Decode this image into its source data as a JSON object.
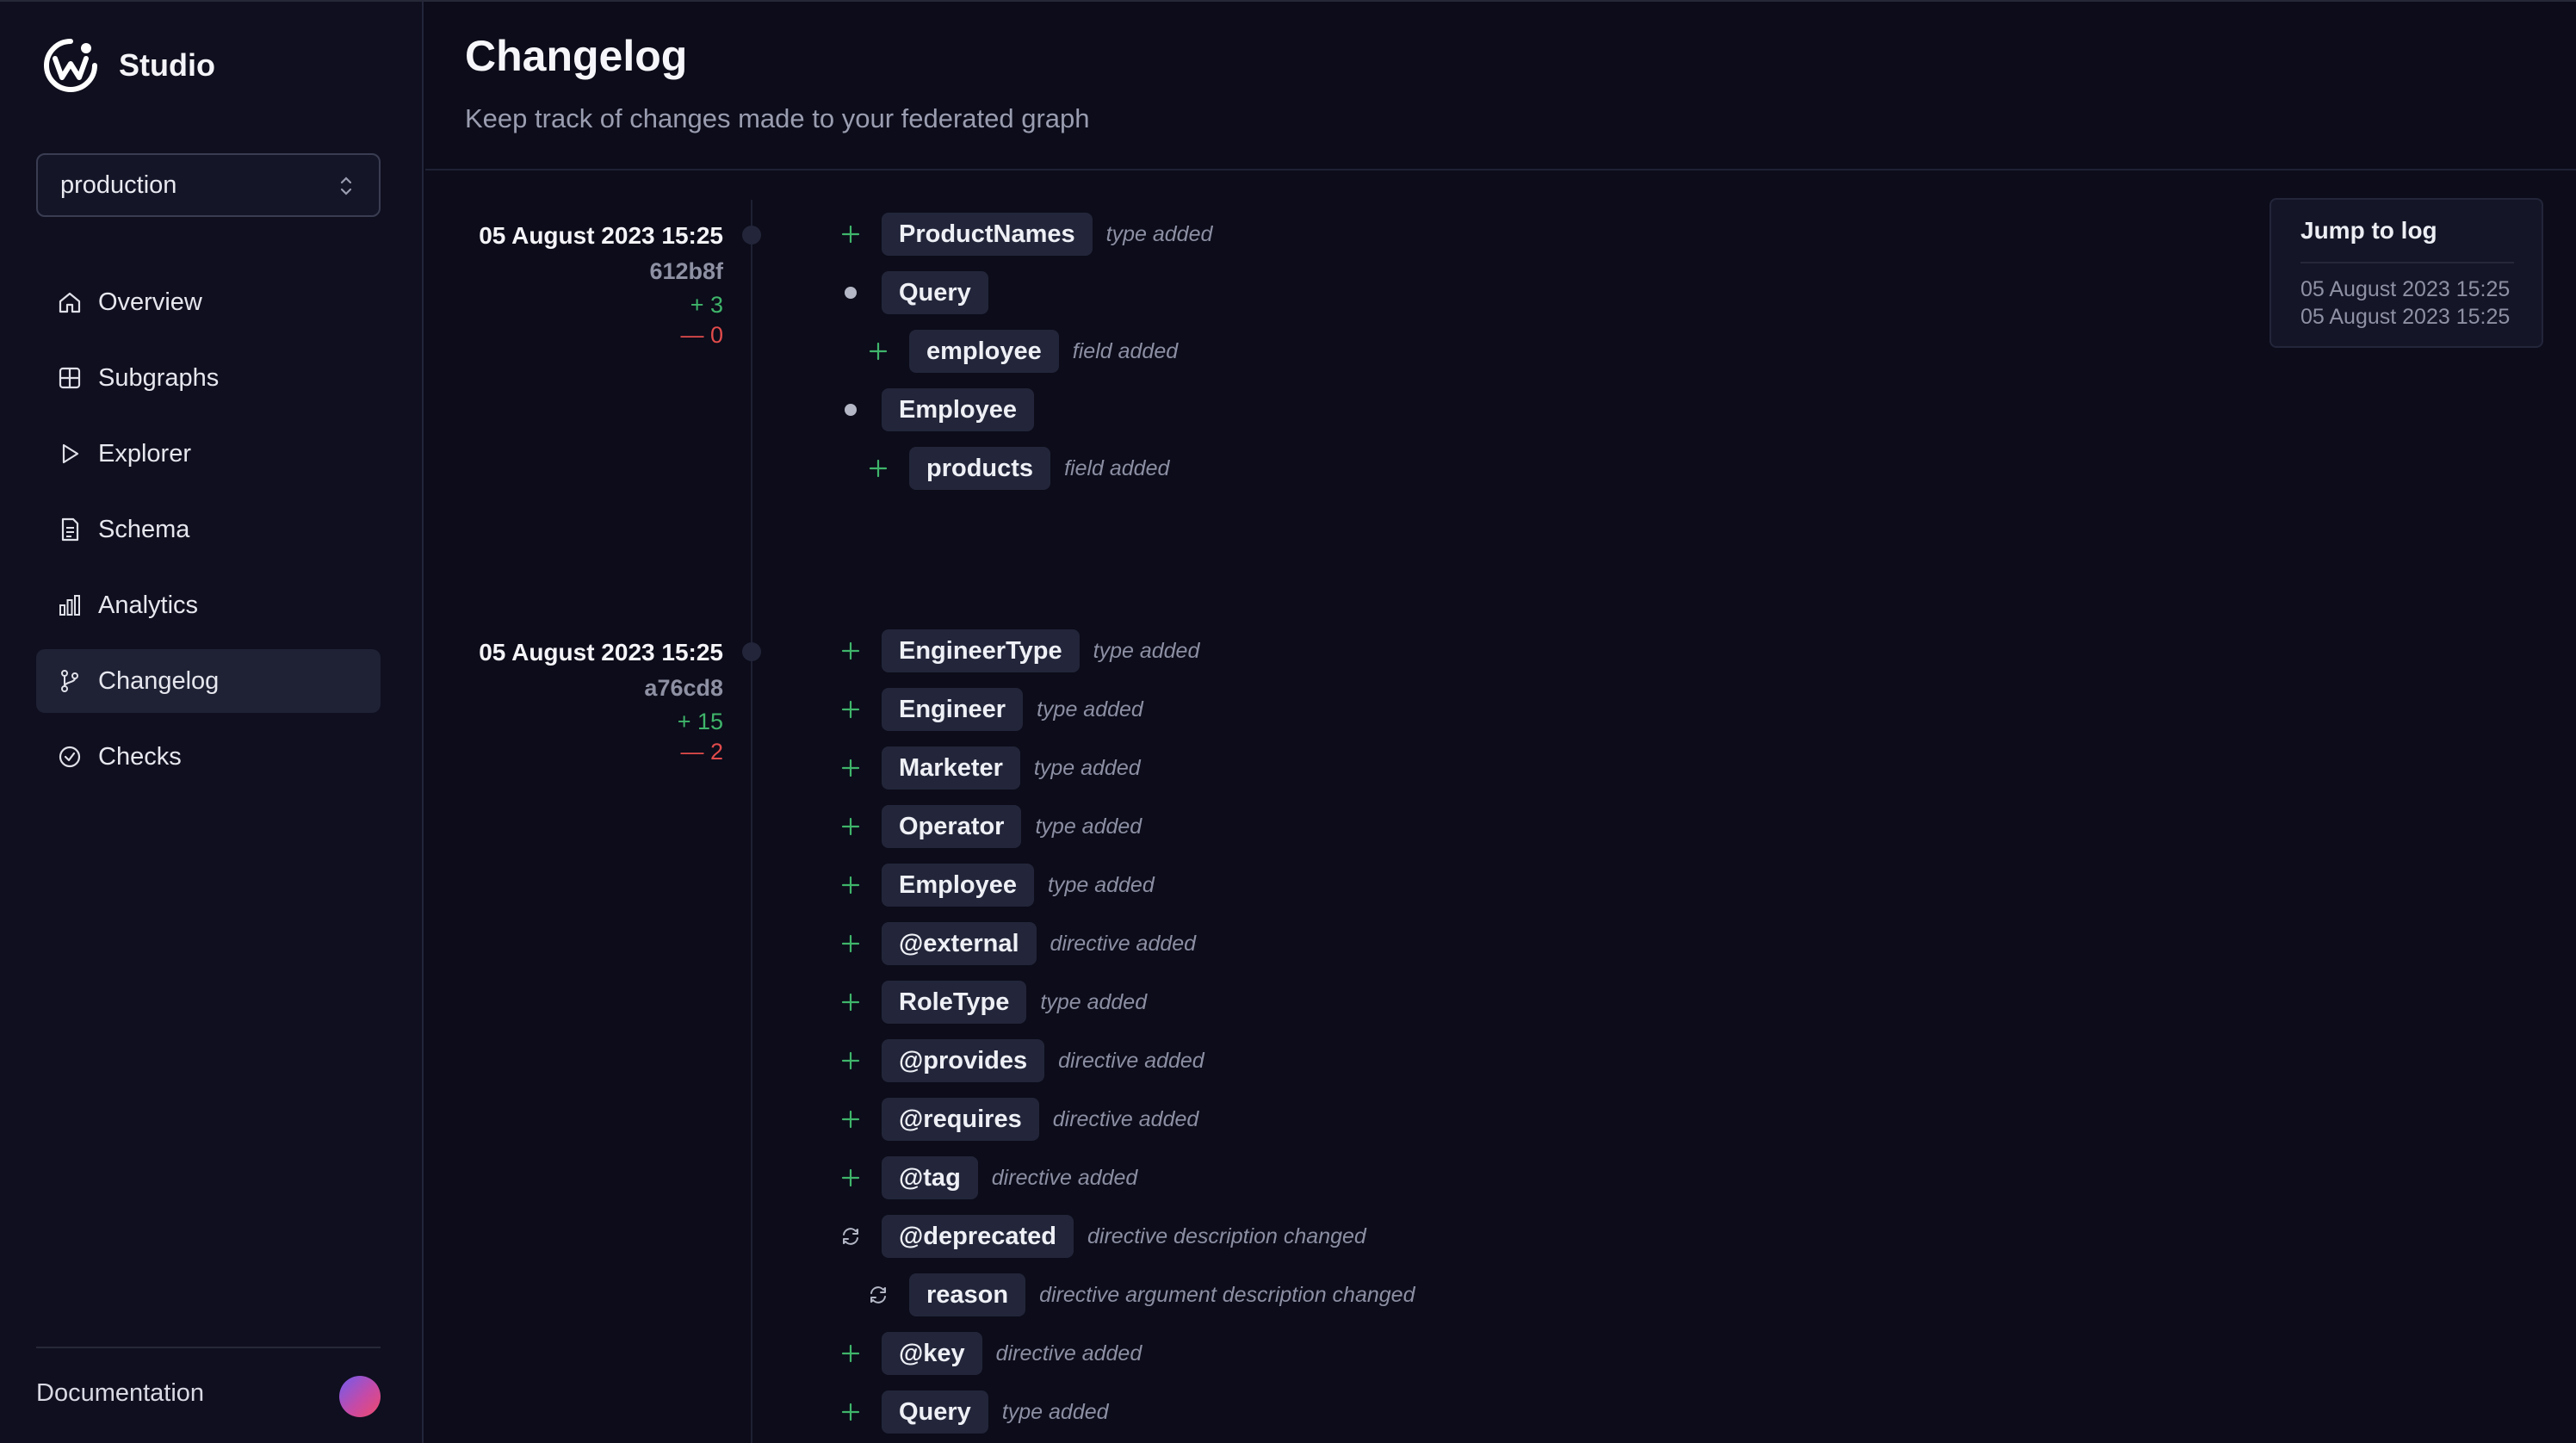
{
  "app": {
    "name": "Studio"
  },
  "graph_selector": {
    "value": "production"
  },
  "nav": {
    "items": [
      {
        "label": "Overview",
        "icon": "home-icon",
        "active": false
      },
      {
        "label": "Subgraphs",
        "icon": "grid-icon",
        "active": false
      },
      {
        "label": "Explorer",
        "icon": "play-icon",
        "active": false
      },
      {
        "label": "Schema",
        "icon": "document-icon",
        "active": false
      },
      {
        "label": "Analytics",
        "icon": "bar-chart-icon",
        "active": false
      },
      {
        "label": "Changelog",
        "icon": "git-branch-icon",
        "active": true
      },
      {
        "label": "Checks",
        "icon": "check-circle-icon",
        "active": false
      }
    ]
  },
  "footer": {
    "documentation": "Documentation"
  },
  "page": {
    "title": "Changelog",
    "subtitle": "Keep track of changes made to your federated graph"
  },
  "entries": [
    {
      "date": "05 August 2023 15:25",
      "hash": "612b8f",
      "additions": "+ 3",
      "removals": "— 0",
      "changes": [
        {
          "kind": "added",
          "name": "ProductNames",
          "desc": "type added",
          "nested": false
        },
        {
          "kind": "parent",
          "name": "Query",
          "desc": "",
          "nested": false
        },
        {
          "kind": "added",
          "name": "employee",
          "desc": "field added",
          "nested": true
        },
        {
          "kind": "parent",
          "name": "Employee",
          "desc": "",
          "nested": false
        },
        {
          "kind": "added",
          "name": "products",
          "desc": "field added",
          "nested": true
        }
      ]
    },
    {
      "date": "05 August 2023 15:25",
      "hash": "a76cd8",
      "additions": "+ 15",
      "removals": "— 2",
      "changes": [
        {
          "kind": "added",
          "name": "EngineerType",
          "desc": "type added",
          "nested": false
        },
        {
          "kind": "added",
          "name": "Engineer",
          "desc": "type added",
          "nested": false
        },
        {
          "kind": "added",
          "name": "Marketer",
          "desc": "type added",
          "nested": false
        },
        {
          "kind": "added",
          "name": "Operator",
          "desc": "type added",
          "nested": false
        },
        {
          "kind": "added",
          "name": "Employee",
          "desc": "type added",
          "nested": false
        },
        {
          "kind": "added",
          "name": "@external",
          "desc": "directive added",
          "nested": false
        },
        {
          "kind": "added",
          "name": "RoleType",
          "desc": "type added",
          "nested": false
        },
        {
          "kind": "added",
          "name": "@provides",
          "desc": "directive added",
          "nested": false
        },
        {
          "kind": "added",
          "name": "@requires",
          "desc": "directive added",
          "nested": false
        },
        {
          "kind": "added",
          "name": "@tag",
          "desc": "directive added",
          "nested": false
        },
        {
          "kind": "changed",
          "name": "@deprecated",
          "desc": "directive description changed",
          "nested": false
        },
        {
          "kind": "changed",
          "name": "reason",
          "desc": "directive argument description changed",
          "nested": true
        },
        {
          "kind": "added",
          "name": "@key",
          "desc": "directive added",
          "nested": false
        },
        {
          "kind": "added",
          "name": "Query",
          "desc": "type added",
          "nested": false
        }
      ]
    }
  ],
  "jump_to_log": {
    "title": "Jump to log",
    "links": [
      "05 August 2023 15:25",
      "05 August 2023 15:25"
    ]
  },
  "colors": {
    "added": "#3fb56a",
    "removed": "#e14b4b",
    "accent": "#1f2235"
  }
}
